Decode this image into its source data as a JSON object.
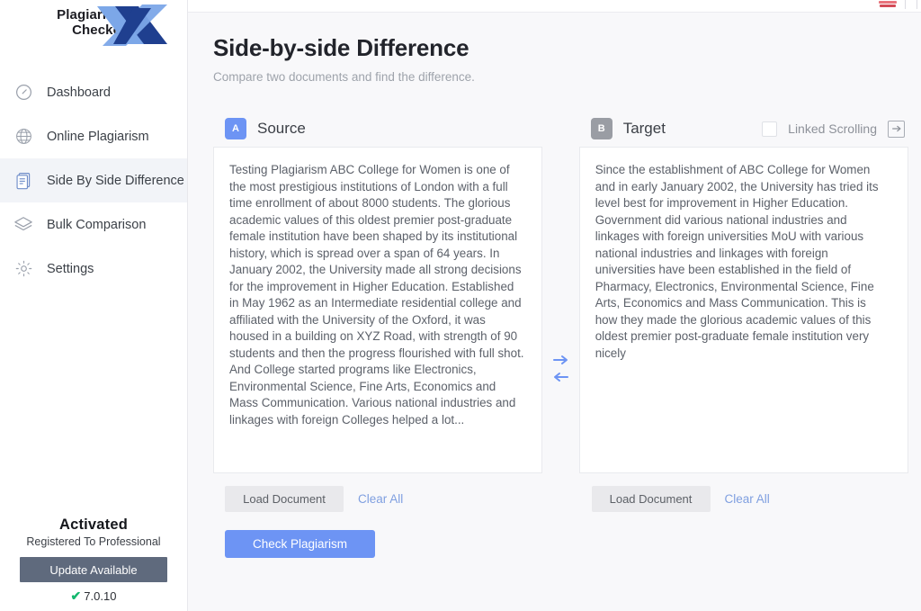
{
  "app": {
    "logo_line1": "Plagiarism",
    "logo_line2": "Checker",
    "logo_mark": "X"
  },
  "titlebar": {
    "minimize_icon": "minimize-icon",
    "window_icon": "window-controls-icon"
  },
  "sidebar": {
    "items": [
      {
        "label": "Dashboard",
        "icon": "dashboard-gauge-icon",
        "active": false
      },
      {
        "label": "Online Plagiarism",
        "icon": "globe-icon",
        "active": false
      },
      {
        "label": "Side By Side Difference",
        "icon": "documents-icon",
        "active": true
      },
      {
        "label": "Bulk Comparison",
        "icon": "stack-layers-icon",
        "active": false
      },
      {
        "label": "Settings",
        "icon": "gear-icon",
        "active": false
      }
    ],
    "footer": {
      "status": "Activated",
      "registration": "Registered To Professional",
      "update_button": "Update Available",
      "version": "7.0.10",
      "version_check_icon": "check-icon"
    }
  },
  "header": {
    "title": "Side-by-side Difference",
    "subtitle": "Compare two documents and find the difference."
  },
  "source": {
    "badge": "A",
    "label": "Source",
    "text": "Testing Plagiarism ABC College for Women is one of the most prestigious institutions of London with a full time enrollment of about 8000 students. The glorious academic values of this oldest premier post-graduate female institution have been shaped by its institutional history, which is spread over a span of 64 years. In January 2002, the University made all strong decisions for the improvement in Higher Education. Established in May 1962 as an Intermediate residential college and affiliated with the University of the Oxford, it was housed in a building on XYZ Road, with strength of 90 students and then the progress flourished with full shot. And College started programs like Electronics, Environmental Science, Fine Arts, Economics and Mass Communication. Various national industries and linkages with foreign Colleges helped a lot...",
    "load_button": "Load Document",
    "clear_link": "Clear All"
  },
  "target": {
    "badge": "B",
    "label": "Target",
    "text": "Since the establishment of ABC College for Women and in early January 2002, the University has tried its level best for improvement in Higher Education. Government did various national industries and linkages with foreign universities MoU with various national industries and linkages with foreign universities have been established in the field of Pharmacy, Electronics, Environmental Science, Fine Arts, Economics and Mass Communication. This is how they made the glorious academic values of this oldest premier post-graduate female institution very nicely",
    "load_button": "Load Document",
    "clear_link": "Clear All",
    "linked_scrolling_label": "Linked Scrolling",
    "linked_scrolling_checked": false,
    "export_icon": "export-arrow-box-icon"
  },
  "swap": {
    "to_target_icon": "arrow-right-icon",
    "to_source_icon": "arrow-left-icon"
  },
  "primary_action": {
    "label": "Check Plagiarism"
  },
  "colors": {
    "accent_blue": "#6d94f4",
    "badge_gray": "#9a9da4",
    "update_button": "#5f6a7d",
    "check_green": "#14b86e",
    "link_blue": "#7f9fe0"
  }
}
